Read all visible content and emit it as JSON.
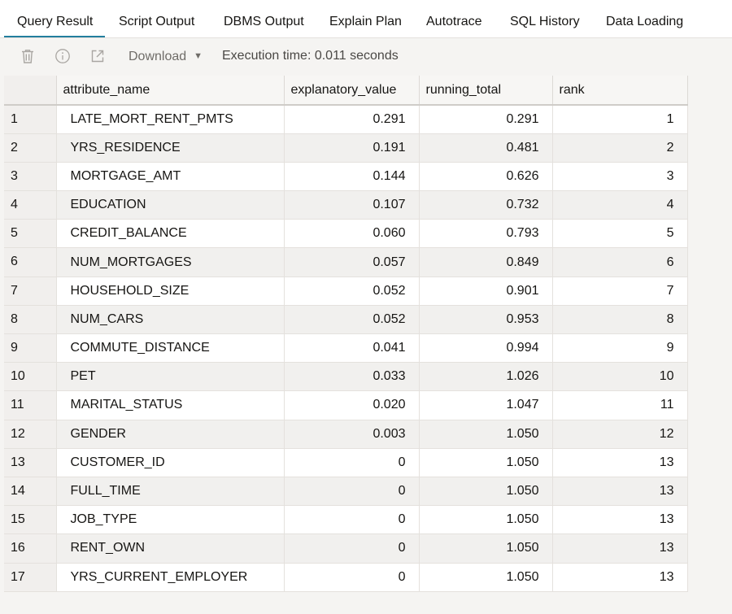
{
  "tabs": [
    {
      "label": "Query Result",
      "active": true
    },
    {
      "label": "Script Output",
      "active": false
    },
    {
      "label": "DBMS Output",
      "active": false
    },
    {
      "label": "Explain Plan",
      "active": false
    },
    {
      "label": "Autotrace",
      "active": false
    },
    {
      "label": "SQL History",
      "active": false
    },
    {
      "label": "Data Loading",
      "active": false
    }
  ],
  "toolbar": {
    "delete_icon": "trash-icon",
    "info_icon": "info-icon",
    "open_icon": "external-link-icon",
    "download_label": "Download",
    "execution_time": "Execution time: 0.011 seconds"
  },
  "grid": {
    "columns": [
      "attribute_name",
      "explanatory_value",
      "running_total",
      "rank"
    ],
    "rows": [
      {
        "n": "1",
        "attribute_name": "LATE_MORT_RENT_PMTS",
        "explanatory_value": "0.291",
        "running_total": "0.291",
        "rank": "1"
      },
      {
        "n": "2",
        "attribute_name": "YRS_RESIDENCE",
        "explanatory_value": "0.191",
        "running_total": "0.481",
        "rank": "2"
      },
      {
        "n": "3",
        "attribute_name": "MORTGAGE_AMT",
        "explanatory_value": "0.144",
        "running_total": "0.626",
        "rank": "3"
      },
      {
        "n": "4",
        "attribute_name": "EDUCATION",
        "explanatory_value": "0.107",
        "running_total": "0.732",
        "rank": "4"
      },
      {
        "n": "5",
        "attribute_name": "CREDIT_BALANCE",
        "explanatory_value": "0.060",
        "running_total": "0.793",
        "rank": "5"
      },
      {
        "n": "6",
        "attribute_name": "NUM_MORTGAGES",
        "explanatory_value": "0.057",
        "running_total": "0.849",
        "rank": "6"
      },
      {
        "n": "7",
        "attribute_name": "HOUSEHOLD_SIZE",
        "explanatory_value": "0.052",
        "running_total": "0.901",
        "rank": "7"
      },
      {
        "n": "8",
        "attribute_name": "NUM_CARS",
        "explanatory_value": "0.052",
        "running_total": "0.953",
        "rank": "8"
      },
      {
        "n": "9",
        "attribute_name": "COMMUTE_DISTANCE",
        "explanatory_value": "0.041",
        "running_total": "0.994",
        "rank": "9"
      },
      {
        "n": "10",
        "attribute_name": "PET",
        "explanatory_value": "0.033",
        "running_total": "1.026",
        "rank": "10"
      },
      {
        "n": "11",
        "attribute_name": "MARITAL_STATUS",
        "explanatory_value": "0.020",
        "running_total": "1.047",
        "rank": "11"
      },
      {
        "n": "12",
        "attribute_name": "GENDER",
        "explanatory_value": "0.003",
        "running_total": "1.050",
        "rank": "12"
      },
      {
        "n": "13",
        "attribute_name": "CUSTOMER_ID",
        "explanatory_value": "0",
        "running_total": "1.050",
        "rank": "13"
      },
      {
        "n": "14",
        "attribute_name": "FULL_TIME",
        "explanatory_value": "0",
        "running_total": "1.050",
        "rank": "13"
      },
      {
        "n": "15",
        "attribute_name": "JOB_TYPE",
        "explanatory_value": "0",
        "running_total": "1.050",
        "rank": "13"
      },
      {
        "n": "16",
        "attribute_name": "RENT_OWN",
        "explanatory_value": "0",
        "running_total": "1.050",
        "rank": "13"
      },
      {
        "n": "17",
        "attribute_name": "YRS_CURRENT_EMPLOYER",
        "explanatory_value": "0",
        "running_total": "1.050",
        "rank": "13"
      }
    ]
  },
  "colors": {
    "active_tab_underline": "#227e9e",
    "toolbar_bg": "#f5f4f2",
    "zebra_row": "#f1f0ee"
  }
}
